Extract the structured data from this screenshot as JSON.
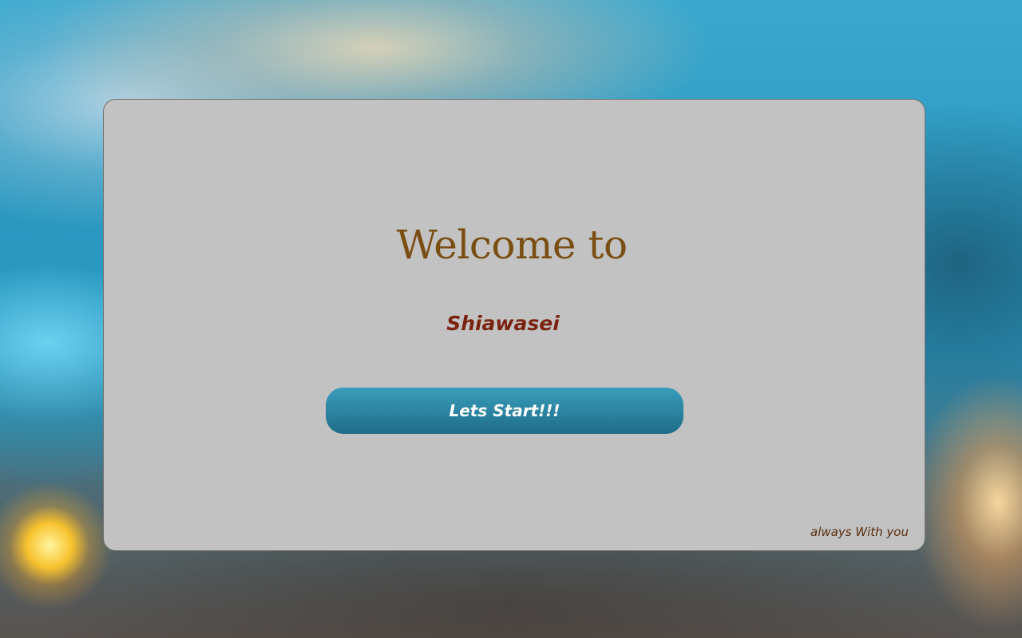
{
  "welcome": {
    "heading": "Welcome to",
    "brand": "Shiawasei",
    "start_button_label": "Lets Start!!!",
    "tagline": "always With you"
  },
  "colors": {
    "heading": "#7a4d12",
    "brand": "#7a2310",
    "button": "#2a83a0",
    "card": "#c1c2c1"
  }
}
